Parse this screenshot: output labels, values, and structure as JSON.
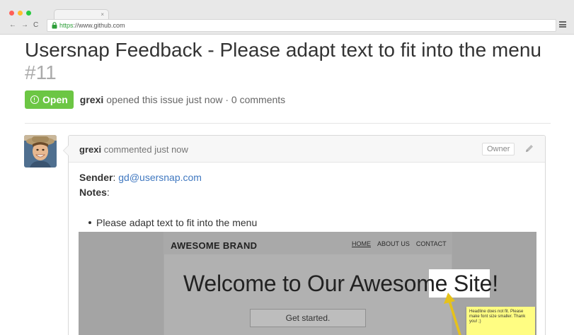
{
  "browser": {
    "url_scheme": "https",
    "url_rest": "://www.github.com",
    "tab_close": "×",
    "back": "←",
    "forward": "→",
    "reload": "C",
    "colors": {
      "close": "#ff5f57",
      "minimize": "#ffbd2e",
      "maximize": "#28c940"
    }
  },
  "issue": {
    "title": "Usersnap Feedback - Please adapt text to fit into the menu",
    "number": "#11",
    "state": "Open",
    "state_color": "#6cc644",
    "author": "grexi",
    "meta_text": "opened this issue just now · 0 comments"
  },
  "comment": {
    "author": "grexi",
    "action": "commented just now",
    "badge": "Owner",
    "sender_label": "Sender",
    "sender_email": "gd@usersnap.com",
    "notes_label": "Notes",
    "note_items": [
      "Please adapt text to fit into the menu"
    ]
  },
  "screenshot": {
    "brand": "AWESOME BRAND",
    "nav": [
      "HOME",
      "ABOUT US",
      "CONTACT"
    ],
    "headline": "Welcome to Our Awesome Site!",
    "cta": "Get started.",
    "sticky_note": "Headline does not fit. Please make font size smaller. Thank you! ;)"
  }
}
